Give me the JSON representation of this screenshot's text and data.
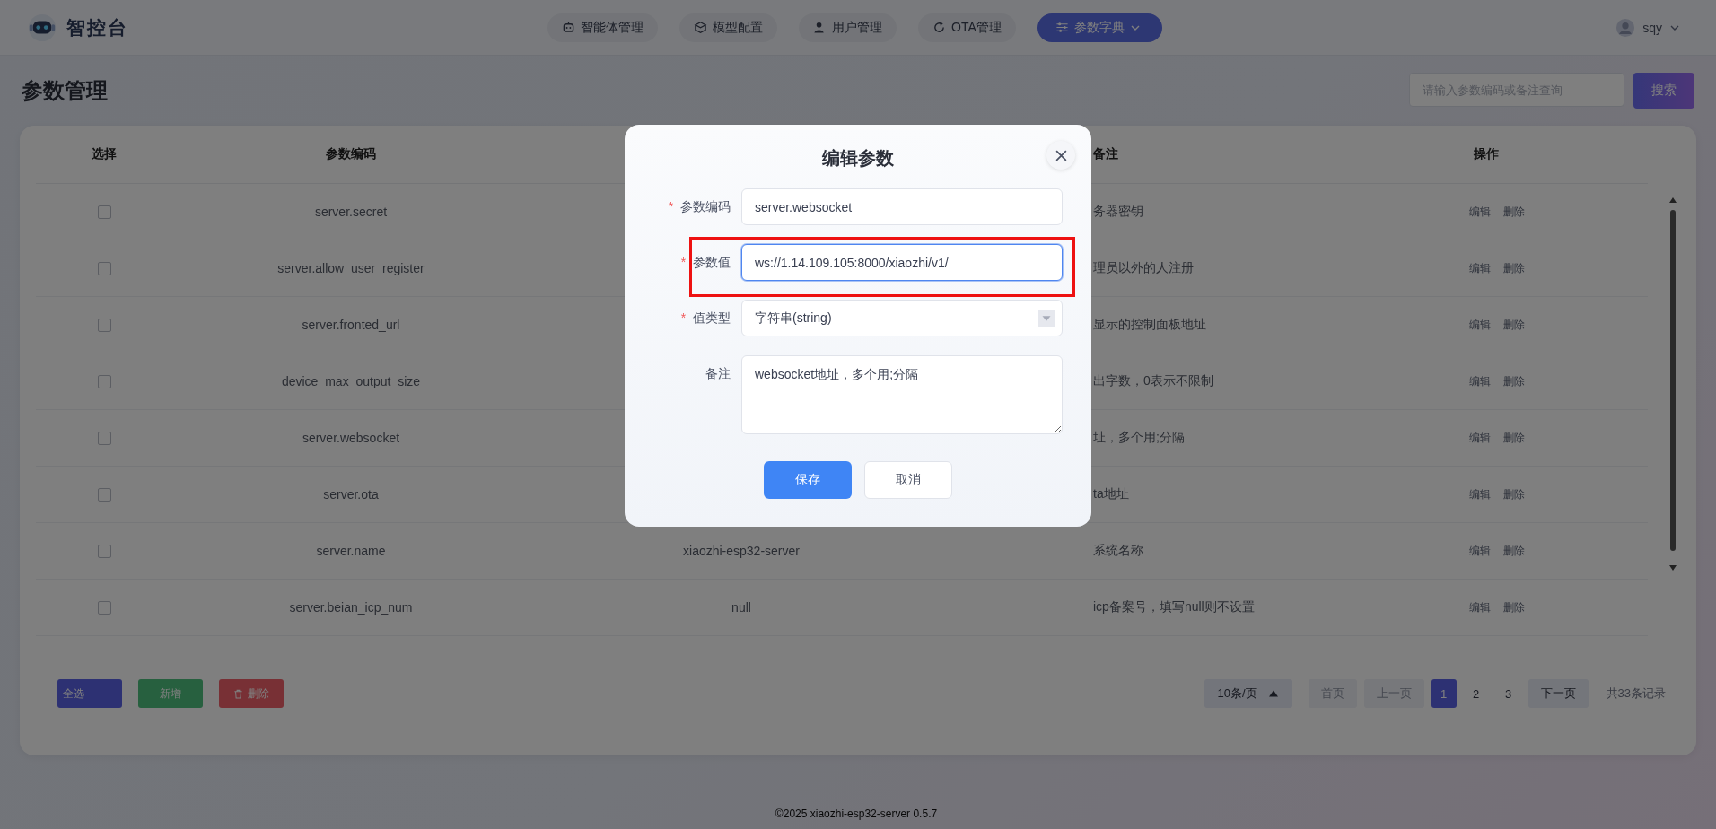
{
  "header": {
    "brand": "智控台",
    "nav": [
      {
        "label": "智能体管理",
        "selected": false,
        "dropdown": false
      },
      {
        "label": "模型配置",
        "selected": false,
        "dropdown": false
      },
      {
        "label": "用户管理",
        "selected": false,
        "dropdown": false
      },
      {
        "label": "OTA管理",
        "selected": false,
        "dropdown": false
      },
      {
        "label": "参数字典",
        "selected": true,
        "dropdown": true
      }
    ],
    "user": "sqy"
  },
  "page_title": "参数管理",
  "search": {
    "placeholder": "请输入参数编码或备注查询",
    "button": "搜索"
  },
  "table": {
    "columns": [
      "选择",
      "参数编码",
      "备注",
      "操作"
    ],
    "rows": [
      {
        "checked": false,
        "code": "server.secret",
        "remark": "务器密钥",
        "actions": [
          "编辑",
          "删除"
        ]
      },
      {
        "checked": false,
        "code": "server.allow_user_register",
        "remark": "理员以外的人注册",
        "actions": [
          "编辑",
          "删除"
        ]
      },
      {
        "checked": false,
        "code": "server.fronted_url",
        "remark": "显示的控制面板地址",
        "actions": [
          "编辑",
          "删除"
        ]
      },
      {
        "checked": false,
        "code": "device_max_output_size",
        "remark": "出字数，0表示不限制",
        "actions": [
          "编辑",
          "删除"
        ]
      },
      {
        "checked": false,
        "code": "server.websocket",
        "remark": "址，多个用;分隔",
        "actions": [
          "编辑",
          "删除"
        ]
      },
      {
        "checked": false,
        "code": "server.ota",
        "remark": "ta地址",
        "actions": [
          "编辑",
          "删除"
        ]
      },
      {
        "checked": false,
        "code": "server.name",
        "value": "xiaozhi-esp32-server",
        "remark": "系统名称",
        "actions": [
          "编辑",
          "删除"
        ]
      },
      {
        "checked": false,
        "code": "server.beian_icp_num",
        "value": "null",
        "remark": "icp备案号，填写null则不设置",
        "actions": [
          "编辑",
          "删除"
        ]
      }
    ]
  },
  "bulk_actions": [
    {
      "label": "全选",
      "kind": "select"
    },
    {
      "label": "新增",
      "kind": "add"
    },
    {
      "label": "删除",
      "kind": "delete"
    }
  ],
  "pagination": {
    "page_size": "10条/页",
    "first": "首页",
    "prev": "上一页",
    "pages": [
      {
        "label": "1",
        "selected": true
      },
      {
        "label": "2",
        "selected": false
      },
      {
        "label": "3",
        "selected": false
      }
    ],
    "next": "下一页",
    "total": "共33条记录"
  },
  "footer": "©2025 xiaozhi-esp32-server 0.5.7",
  "dialog": {
    "title": "编辑参数",
    "fields": [
      {
        "label": "参数编码",
        "required_mark": "*",
        "kind": "input",
        "value": "server.websocket",
        "focused": false,
        "highlighted": false
      },
      {
        "label": "参数值",
        "required_mark": "*",
        "kind": "input",
        "value": "ws://1.14.109.105:8000/xiaozhi/v1/",
        "focused": true,
        "highlighted": true
      },
      {
        "label": "值类型",
        "required_mark": "*",
        "kind": "select",
        "value": "字符串(string)",
        "focused": false,
        "highlighted": false
      },
      {
        "label": "备注",
        "kind": "textarea",
        "value": "websocket地址，多个用;分隔",
        "focused": false,
        "highlighted": false
      }
    ],
    "save": "保存",
    "cancel": "取消"
  }
}
